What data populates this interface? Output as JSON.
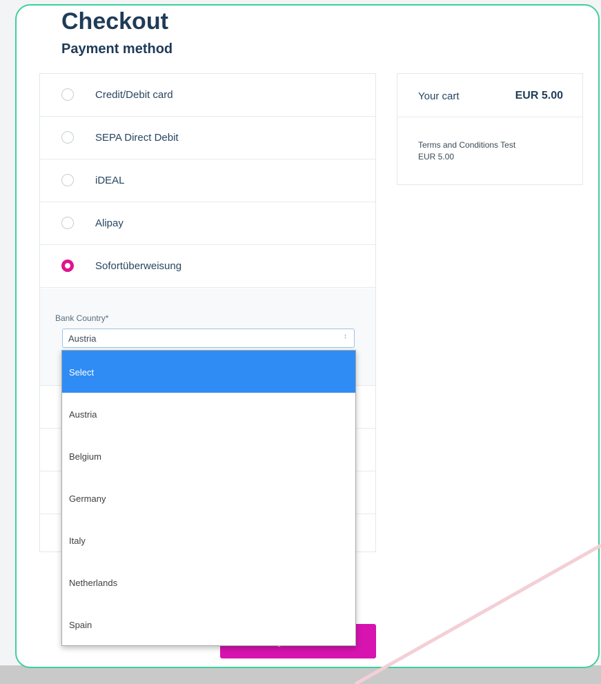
{
  "page": {
    "title": "Checkout",
    "subtitle": "Payment method"
  },
  "payment_methods": [
    {
      "label": "Credit/Debit card",
      "selected": false
    },
    {
      "label": "SEPA Direct Debit",
      "selected": false
    },
    {
      "label": "iDEAL",
      "selected": false
    },
    {
      "label": "Alipay",
      "selected": false
    },
    {
      "label": "Sofortüberweisung",
      "selected": true
    }
  ],
  "bank_country": {
    "label": "Bank Country*",
    "value": "Austria",
    "options": [
      "Select",
      "Austria",
      "Belgium",
      "Germany",
      "Italy",
      "Netherlands",
      "Spain"
    ],
    "highlighted_option": "Select"
  },
  "cart": {
    "label": "Your cart",
    "total": "EUR 5.00",
    "item_name": "Terms and Conditions Test",
    "item_price": "EUR 5.00"
  },
  "pay_button": {
    "label": "Pay EUR 5.00"
  },
  "colors": {
    "accent_pink": "#e0138c",
    "button_magenta": "#d713b0",
    "frame_border": "#3fcf9c",
    "dropdown_highlight": "#2f8cf4",
    "heading_navy": "#1f3b57"
  },
  "icons": {
    "radio_unchecked": "radio-unchecked-icon",
    "radio_checked": "radio-checked-icon",
    "select_arrows": "select-arrows-icon"
  }
}
